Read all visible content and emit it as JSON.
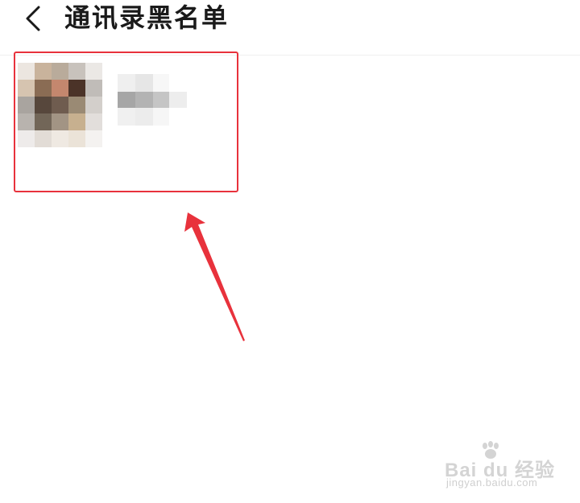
{
  "header": {
    "title": "通讯录黑名单",
    "back_icon": "chevron-left-icon"
  },
  "blacklist": {
    "items": [
      {
        "avatar": "pixelated-avatar",
        "name_pixelated": true
      }
    ]
  },
  "annotation": {
    "box_color": "#e8323c",
    "arrow_color": "#e8323c"
  },
  "watermark": {
    "brand": "Bai du 经验",
    "url": "jingyan.baidu.com"
  }
}
